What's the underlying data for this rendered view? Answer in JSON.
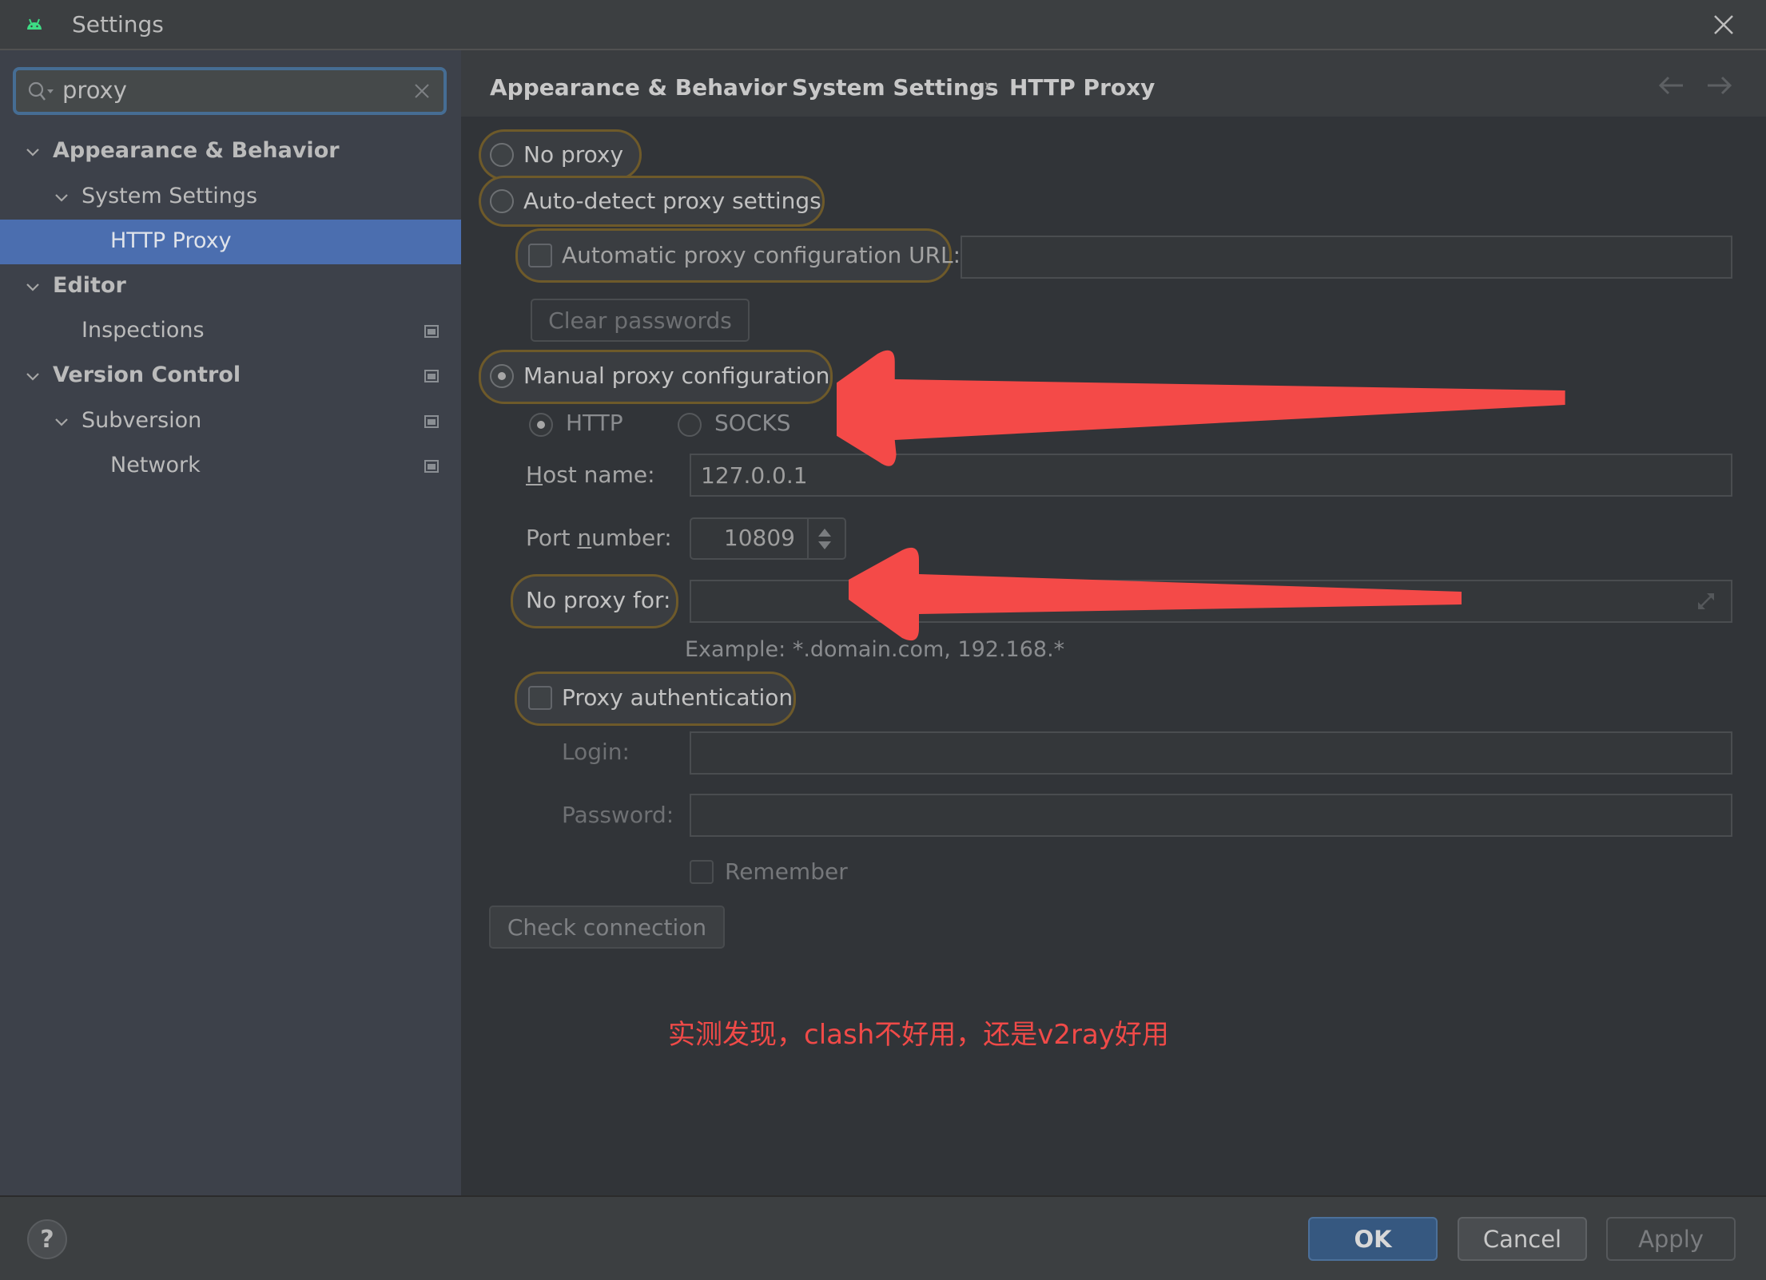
{
  "window": {
    "title": "Settings",
    "app_icon": "android-icon",
    "close_icon": "close-icon"
  },
  "sidebar": {
    "search": {
      "value": "proxy",
      "placeholder": ""
    },
    "tree": [
      {
        "label": "Appearance & Behavior",
        "bold": true,
        "expanded": true,
        "level": 0
      },
      {
        "label": "System Settings",
        "bold": false,
        "expanded": true,
        "level": 1
      },
      {
        "label": "HTTP Proxy",
        "bold": false,
        "selected": true,
        "level": 2
      },
      {
        "label": "Editor",
        "bold": true,
        "expanded": true,
        "level": 0
      },
      {
        "label": "Inspections",
        "bold": false,
        "level": 1,
        "project_icon": true
      },
      {
        "label": "Version Control",
        "bold": true,
        "expanded": true,
        "level": 0,
        "project_icon": true
      },
      {
        "label": "Subversion",
        "bold": false,
        "expanded": true,
        "level": 1,
        "project_icon": true
      },
      {
        "label": "Network",
        "bold": false,
        "level": 2,
        "project_icon": true
      }
    ]
  },
  "breadcrumb": [
    "Appearance & Behavior",
    "System Settings",
    "HTTP Proxy"
  ],
  "breadcrumb_separator": "›",
  "proxy": {
    "no_proxy": {
      "label": "No proxy",
      "selected": false
    },
    "auto_detect": {
      "label": "Auto-detect proxy settings",
      "selected": false
    },
    "auto_config_url": {
      "label": "Automatic proxy configuration URL:",
      "checked": false,
      "value": ""
    },
    "clear_passwords": "Clear passwords",
    "manual": {
      "label": "Manual proxy configuration",
      "selected": true
    },
    "protocol": {
      "http": {
        "label": "HTTP",
        "selected": true
      },
      "socks": {
        "label": "SOCKS",
        "selected": false
      }
    },
    "host": {
      "label_pre": "",
      "label_u": "H",
      "label_post": "ost name:",
      "value": "127.0.0.1"
    },
    "port": {
      "label_pre": "Port ",
      "label_u": "n",
      "label_post": "umber:",
      "value": "10809"
    },
    "no_proxy_for": {
      "label": "No proxy for:",
      "value": ""
    },
    "example": "Example: *.domain.com, 192.168.*",
    "auth": {
      "label": "Proxy authentication",
      "checked": false
    },
    "login": {
      "label": "Login:",
      "value": ""
    },
    "password": {
      "label": "Password:",
      "value": ""
    },
    "remember": {
      "label": "Remember",
      "checked": false
    },
    "check_connection": "Check connection"
  },
  "annotation": {
    "note": "实测发现，clash不好用，还是v2ray好用",
    "arrow_color": "#f44a48",
    "highlight_color": "#6e5a2a"
  },
  "footer": {
    "help": "?",
    "ok": "OK",
    "cancel": "Cancel",
    "apply": "Apply"
  },
  "colors": {
    "accent": "#4b6eaf",
    "ok_button": "#365880",
    "search_focus": "#466d94"
  }
}
